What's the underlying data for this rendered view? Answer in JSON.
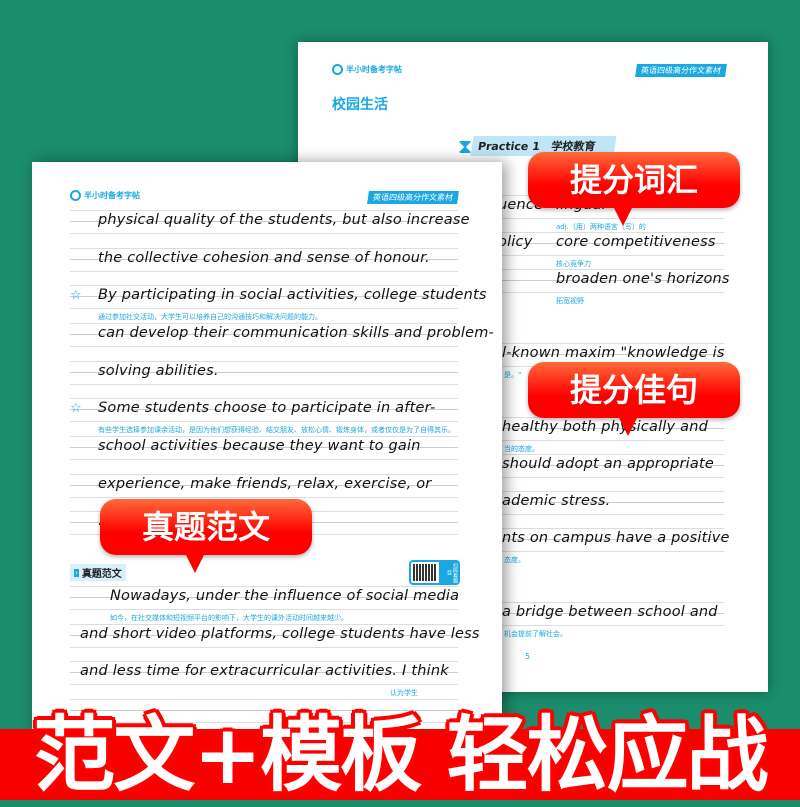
{
  "back_page": {
    "brand": "半小时备考字帖",
    "tag": "英语四级高分作文素材",
    "section_title": "校园生活",
    "practice_label": "Practice 1",
    "practice_topic": "学校教育",
    "page_number": "5",
    "rows": [
      {
        "left": "uence",
        "right": "lingual",
        "cn": "adj.（用）两种语言（写）的"
      },
      {
        "left": "olicy",
        "right": "core competitiveness",
        "cn": "核心竞争力"
      },
      {
        "left": "",
        "right": "broaden one's horizons",
        "cn": "拓宽视野"
      },
      {
        "text": "l-known  maxim  \"knowledge  is",
        "cn": "是。\""
      },
      {
        "text": "healthy  both  physically  and",
        "cn": "当的态度。"
      },
      {
        "text": "should  adopt  an  appropriate"
      },
      {
        "text": "ademic  stress."
      },
      {
        "text": "nts on campus have a positive",
        "cn": "态度。"
      },
      {
        "text": "a  bridge  between  school  and",
        "cn": "机会提前了解社会。"
      }
    ]
  },
  "front_page": {
    "brand": "半小时备考字帖",
    "tag": "英语四级高分作文素材",
    "rows": [
      {
        "text": "physical quality of the students, but also increase"
      },
      {
        "text": "the collective cohesion and sense of honour."
      },
      {
        "text": "By participating in social activities, college students",
        "star": true,
        "cn": "通过参加社交活动，大学生可以培养自己的沟通技巧和解决问题的能力。"
      },
      {
        "text": "can develop their communication skills and problem-"
      },
      {
        "text": "solving abilities."
      },
      {
        "text": "Some  students  choose  to  participate  in  after-",
        "star": true,
        "cn": "有些学生选择参加课余活动，是因为他们想获得经验、结交朋友、放松心情、锻炼身体，或者仅仅是为了自得其乐。"
      },
      {
        "text": "school  activities  because  they  want  to  gain"
      },
      {
        "text": "experience,  make  friends,  relax,  exercise,  or"
      },
      {
        "text": "."
      }
    ],
    "section_label": "真题范文",
    "qr_label": "扫码看题目",
    "essay_rows": [
      {
        "text": "Nowadays,  under  the  influence  of  social  media",
        "cn": "如今，在社交媒体和短视频平台的影响下，大学生的课外活动时间越来越少。"
      },
      {
        "text": "and short video platforms, college students have less"
      },
      {
        "text": "and less time for extracurricular activities. I think",
        "cn": "认为学生"
      }
    ]
  },
  "callouts": {
    "vocab": "提分词汇",
    "sentences": "提分佳句",
    "essays": "真题范文"
  },
  "slogan": "范文+模板 轻松应战",
  "colors": {
    "background": "#1b8d6c",
    "accent": "#1ba8e0",
    "banner": "#f70000"
  }
}
